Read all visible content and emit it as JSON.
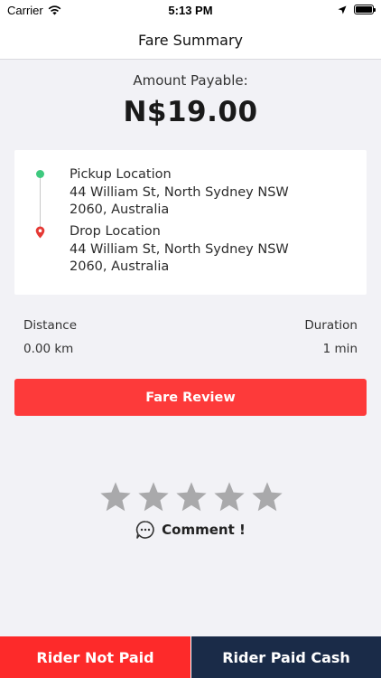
{
  "status_bar": {
    "carrier": "Carrier",
    "time": "5:13 PM",
    "icons": [
      "wifi-icon",
      "location-arrow-icon",
      "battery-icon"
    ]
  },
  "header": {
    "title": "Fare Summary"
  },
  "fare": {
    "amount_label": "Amount Payable:",
    "amount_value": "N$19.00"
  },
  "route": {
    "pickup": {
      "title": "Pickup Location",
      "address_line1": "44 William St, North Sydney NSW",
      "address_line2": "2060, Australia"
    },
    "drop": {
      "title": "Drop Location",
      "address_line1": "44 William St, North Sydney NSW",
      "address_line2": "2060, Australia"
    }
  },
  "trip_stats": {
    "distance_label": "Distance",
    "distance_value": "0.00 km",
    "duration_label": "Duration",
    "duration_value": "1 min"
  },
  "fare_review_button": "Fare Review",
  "rating": {
    "max_stars": 5,
    "selected": 0,
    "comment_label": "Comment !"
  },
  "actions": {
    "rider_not_paid": "Rider Not Paid",
    "rider_paid_cash": "Rider Paid Cash"
  },
  "colors": {
    "accent_red": "#fd3a3a",
    "dark_navy": "#1a2b48",
    "pickup_green": "#3ec97e",
    "drop_red": "#e53935",
    "star_grey": "#a9a9ab"
  }
}
